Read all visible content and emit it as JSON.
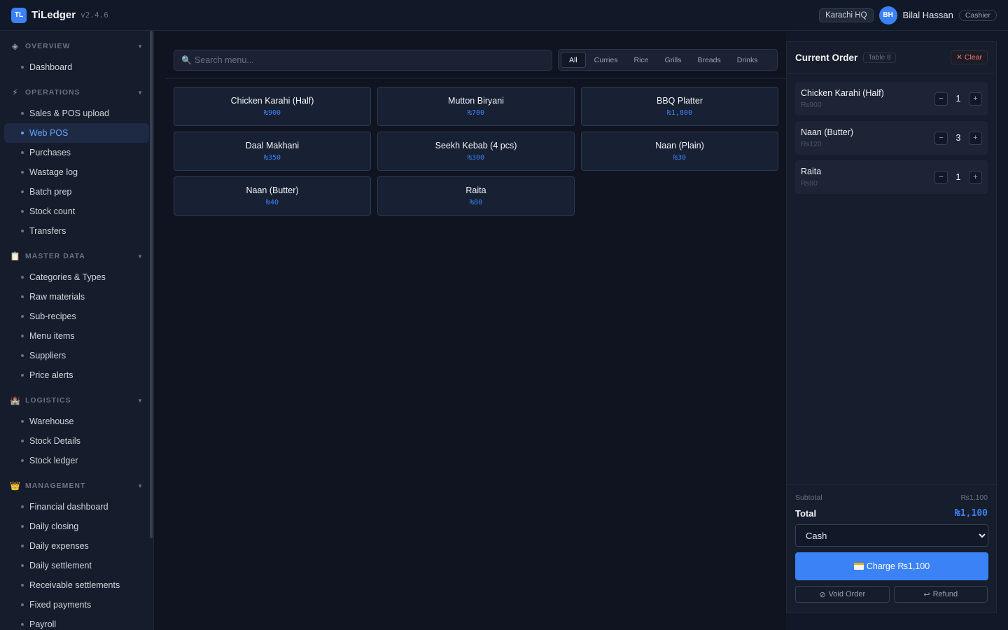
{
  "header": {
    "logo": "TL",
    "app_name": "TiLedger",
    "version": "v2.4.6",
    "location": "Karachi HQ",
    "user_initials": "BH",
    "user_name": "Bilal Hassan",
    "role": "Cashier"
  },
  "sidebar": {
    "sections": [
      {
        "title": "OVERVIEW",
        "icon": "diamond-icon",
        "items": [
          "Dashboard"
        ]
      },
      {
        "title": "OPERATIONS",
        "icon": "lightning-icon",
        "items": [
          "Sales & POS upload",
          "Web POS",
          "Purchases",
          "Wastage log",
          "Batch prep",
          "Stock count",
          "Transfers"
        ]
      },
      {
        "title": "MASTER DATA",
        "icon": "clipboard-icon",
        "items": [
          "Categories & Types",
          "Raw materials",
          "Sub-recipes",
          "Menu items",
          "Suppliers",
          "Price alerts"
        ]
      },
      {
        "title": "LOGISTICS",
        "icon": "castle-icon",
        "items": [
          "Warehouse",
          "Stock Details",
          "Stock ledger"
        ]
      },
      {
        "title": "MANAGEMENT",
        "icon": "crown-icon",
        "items": [
          "Financial dashboard",
          "Daily closing",
          "Daily expenses",
          "Daily settlement",
          "Receivable settlements",
          "Fixed payments",
          "Payroll"
        ]
      }
    ],
    "active_item": "Web POS"
  },
  "search": {
    "placeholder": "Search menu...",
    "value": ""
  },
  "categories": [
    "All",
    "Curries",
    "Rice",
    "Grills",
    "Breads",
    "Drinks"
  ],
  "active_category": "All",
  "menu_items": [
    {
      "name": "Chicken Karahi (Half)",
      "price": "₨900"
    },
    {
      "name": "Mutton Biryani",
      "price": "₨700"
    },
    {
      "name": "BBQ Platter",
      "price": "₨1,800"
    },
    {
      "name": "Daal Makhani",
      "price": "₨350"
    },
    {
      "name": "Seekh Kebab (4 pcs)",
      "price": "₨300"
    },
    {
      "name": "Naan (Plain)",
      "price": "₨30"
    },
    {
      "name": "Naan (Butter)",
      "price": "₨40"
    },
    {
      "name": "Raita",
      "price": "₨80"
    }
  ],
  "order": {
    "title": "Current Order",
    "table": "Table 8",
    "clear_label": "Clear",
    "items": [
      {
        "name": "Chicken Karahi (Half)",
        "price": "₨900",
        "qty": "1"
      },
      {
        "name": "Naan (Butter)",
        "price": "₨120",
        "qty": "3"
      },
      {
        "name": "Raita",
        "price": "₨80",
        "qty": "1"
      }
    ],
    "subtotal_label": "Subtotal",
    "subtotal": "₨1,100",
    "total_label": "Total",
    "total": "₨1,100",
    "payment_method": "Cash",
    "charge_label": "Charge ₨1,100",
    "void_label": "Void Order",
    "refund_label": "Refund"
  }
}
